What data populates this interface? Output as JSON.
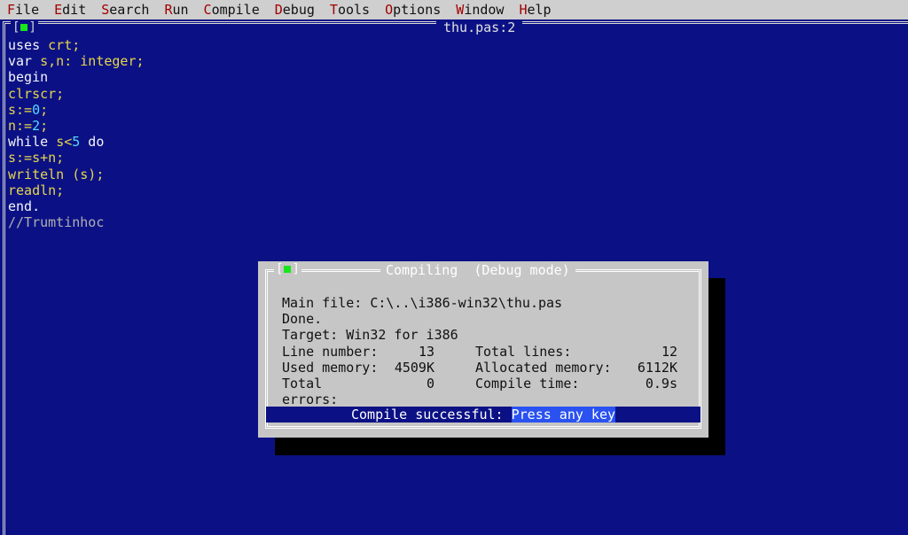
{
  "menu": {
    "items": [
      {
        "hotkey": "F",
        "rest": "ile"
      },
      {
        "hotkey": "E",
        "rest": "dit"
      },
      {
        "hotkey": "S",
        "rest": "earch"
      },
      {
        "hotkey": "R",
        "rest": "un"
      },
      {
        "hotkey": "C",
        "rest": "ompile"
      },
      {
        "hotkey": "D",
        "rest": "ebug"
      },
      {
        "hotkey": "T",
        "rest": "ools"
      },
      {
        "hotkey": "O",
        "rest": "ptions"
      },
      {
        "hotkey": "W",
        "rest": "indow"
      },
      {
        "hotkey": "H",
        "rest": "elp"
      }
    ]
  },
  "editor": {
    "title": "thu.pas:2",
    "window_button": "[■]",
    "code_lines": [
      [
        {
          "t": "uses ",
          "c": "kw"
        },
        {
          "t": "crt;",
          "c": "id"
        }
      ],
      [
        {
          "t": "var ",
          "c": "kw"
        },
        {
          "t": "s,n: integer;",
          "c": "id"
        }
      ],
      [
        {
          "t": "begin",
          "c": "kw"
        }
      ],
      [
        {
          "t": "clrscr;",
          "c": "id"
        }
      ],
      [
        {
          "t": "s:=",
          "c": "id"
        },
        {
          "t": "0",
          "c": "num"
        },
        {
          "t": ";",
          "c": "id"
        }
      ],
      [
        {
          "t": "n:=",
          "c": "id"
        },
        {
          "t": "2",
          "c": "num"
        },
        {
          "t": ";",
          "c": "id"
        }
      ],
      [
        {
          "t": "while ",
          "c": "kw"
        },
        {
          "t": "s<",
          "c": "id"
        },
        {
          "t": "5",
          "c": "num"
        },
        {
          "t": " do",
          "c": "kw"
        }
      ],
      [
        {
          "t": "s:=s+n;",
          "c": "id"
        }
      ],
      [
        {
          "t": "writeln (s);",
          "c": "id"
        }
      ],
      [
        {
          "t": "readln;",
          "c": "id"
        }
      ],
      [
        {
          "t": "end.",
          "c": "kw"
        }
      ],
      [
        {
          "t": "//Trumtinhoc",
          "c": "cmt"
        }
      ]
    ]
  },
  "dialog": {
    "title": "Compiling  (Debug mode)",
    "main_file": "Main file: C:\\..\\i386-win32\\thu.pas",
    "done": "Done.",
    "target": "Target: Win32 for i386",
    "stats": [
      {
        "l1": "Line number:",
        "v1": "13",
        "l2": "Total lines:",
        "v2": "12"
      },
      {
        "l1": "Used memory:",
        "v1": "4509K",
        "l2": "Allocated memory:",
        "v2": "6112K"
      },
      {
        "l1": "Total errors:",
        "v1": "0",
        "l2": "Compile time:",
        "v2": "0.9s"
      }
    ],
    "status_prefix": "Compile successful: ",
    "status_highlight": "Press any key"
  },
  "colors": {
    "editor_bg": "#0b1185",
    "menubar_bg": "#cfcfcf",
    "menu_hotkey": "#a10000",
    "dialog_bg": "#c6c6c6",
    "status_bg": "#0b1185",
    "highlight": "#2a52f0",
    "window_indicator": "#19e619"
  }
}
